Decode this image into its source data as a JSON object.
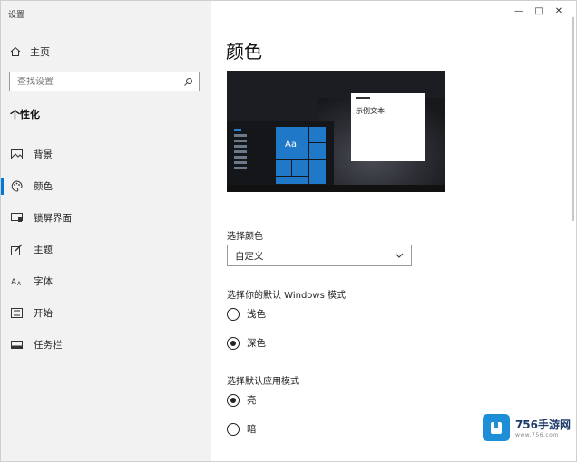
{
  "window": {
    "title": "设置",
    "controls": [
      "—",
      "□",
      "✕"
    ]
  },
  "sidebar": {
    "home_label": "主页",
    "search_placeholder": "查找设置",
    "section_title": "个性化",
    "items": [
      {
        "label": "背景",
        "icon": "picture-icon"
      },
      {
        "label": "颜色",
        "icon": "palette-icon",
        "active": true
      },
      {
        "label": "锁屏界面",
        "icon": "lock-screen-icon"
      },
      {
        "label": "主题",
        "icon": "brush-icon"
      },
      {
        "label": "字体",
        "icon": "font-icon"
      },
      {
        "label": "开始",
        "icon": "start-menu-icon"
      },
      {
        "label": "任务栏",
        "icon": "taskbar-icon"
      }
    ]
  },
  "main": {
    "title": "颜色",
    "preview": {
      "tile_text": "Aa",
      "sample_text": "示例文本"
    },
    "choose_color_label": "选择颜色",
    "choose_color_value": "自定义",
    "windows_mode_label": "选择你的默认 Windows 模式",
    "windows_mode_options": [
      "浅色",
      "深色"
    ],
    "windows_mode_selected": "深色",
    "app_mode_label": "选择默认应用模式",
    "app_mode_options": [
      "亮",
      "暗"
    ],
    "app_mode_selected": "亮"
  },
  "watermark": {
    "title": "756手游网",
    "subtitle": "www.756.com"
  },
  "colors": {
    "accent": "#0078d7",
    "tile_blue": "#1f78c8"
  }
}
